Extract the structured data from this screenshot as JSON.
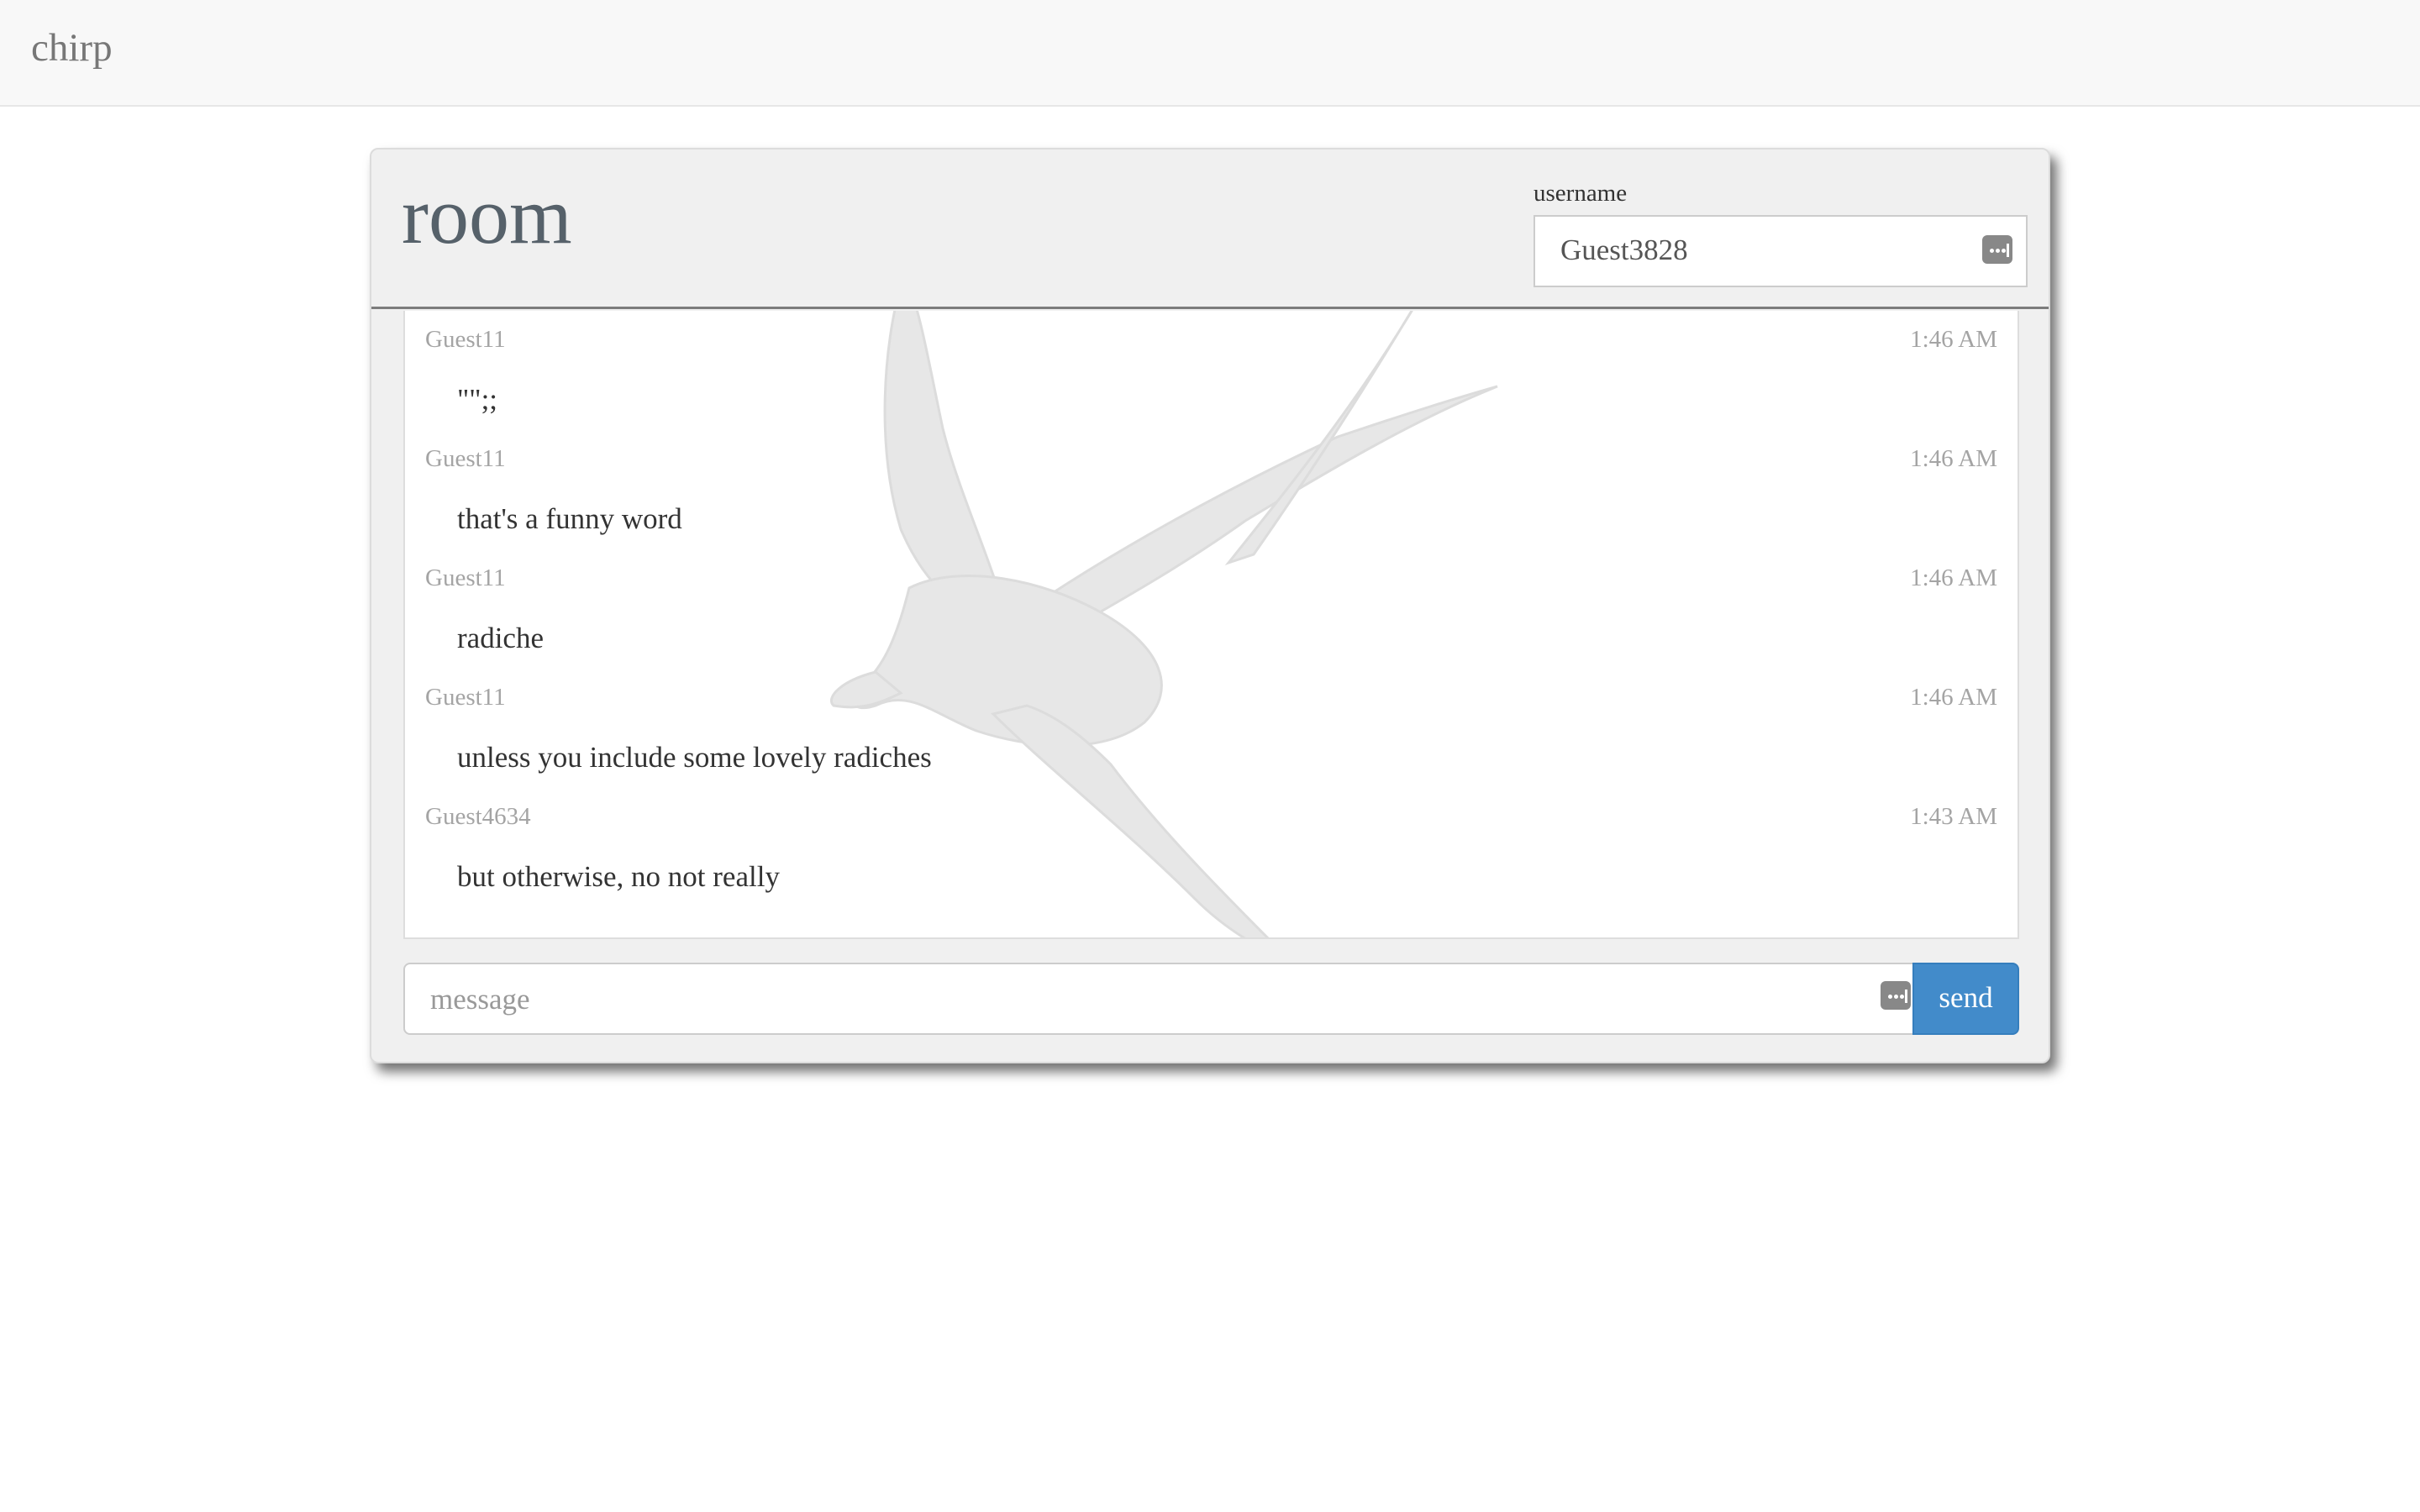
{
  "navbar": {
    "brand": "chirp"
  },
  "room": {
    "title": "room"
  },
  "username": {
    "label": "username",
    "value": "Guest3828"
  },
  "messages": [
    {
      "author": "Guest11",
      "time": "1:46 AM",
      "text": "\"\";;"
    },
    {
      "author": "Guest11",
      "time": "1:46 AM",
      "text": "that's a funny word"
    },
    {
      "author": "Guest11",
      "time": "1:46 AM",
      "text": "radiche"
    },
    {
      "author": "Guest11",
      "time": "1:46 AM",
      "text": "unless you include some lovely radiches"
    },
    {
      "author": "Guest4634",
      "time": "1:43 AM",
      "text": "but otherwise, no not really"
    }
  ],
  "composer": {
    "placeholder": "message",
    "send_label": "send"
  },
  "colors": {
    "accent": "#428bca",
    "background": "#f0f0f0",
    "navbar": "#f8f8f8"
  },
  "icons": {
    "keyboard": "keyboard-icon",
    "watermark": "swallow-bird-illustration"
  }
}
